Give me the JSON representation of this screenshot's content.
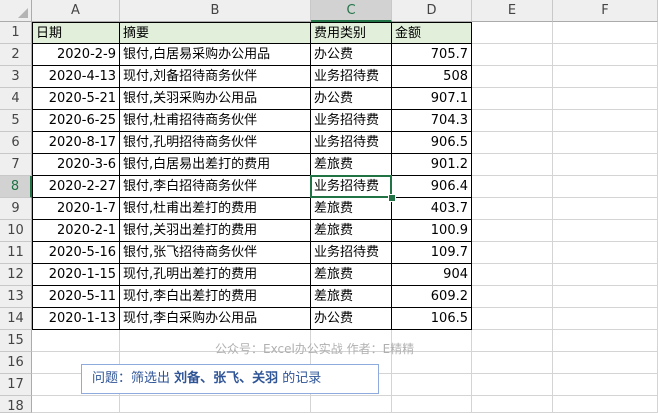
{
  "columns": [
    "A",
    "B",
    "C",
    "D",
    "E",
    "F"
  ],
  "selected_column": "C",
  "selected_row": 8,
  "row_numbers": [
    1,
    2,
    3,
    4,
    5,
    6,
    7,
    8,
    9,
    10,
    11,
    12,
    13,
    14,
    15,
    16,
    17,
    18
  ],
  "table": {
    "headers": [
      "日期",
      "摘要",
      "费用类别",
      "金额"
    ],
    "rows": [
      [
        "2020-2-9",
        "银付,白居易采购办公用品",
        "办公费",
        "705.7"
      ],
      [
        "2020-4-13",
        "现付,刘备招待商务伙伴",
        "业务招待费",
        "508"
      ],
      [
        "2020-5-21",
        "银付,关羽采购办公用品",
        "办公费",
        "907.1"
      ],
      [
        "2020-6-25",
        "银付,杜甫招待商务伙伴",
        "业务招待费",
        "704.3"
      ],
      [
        "2020-8-17",
        "银付,孔明招待商务伙伴",
        "业务招待费",
        "906.5"
      ],
      [
        "2020-3-6",
        "银付,白居易出差打的费用",
        "差旅费",
        "901.2"
      ],
      [
        "2020-2-27",
        "银付,李白招待商务伙伴",
        "业务招待费",
        "906.4"
      ],
      [
        "2020-1-7",
        "银付,杜甫出差打的费用",
        "差旅费",
        "403.7"
      ],
      [
        "2020-2-1",
        "银付,关羽出差打的费用",
        "差旅费",
        "100.9"
      ],
      [
        "2020-5-16",
        "银付,张飞招待商务伙伴",
        "业务招待费",
        "109.7"
      ],
      [
        "2020-1-15",
        "现付,孔明出差打的费用",
        "差旅费",
        "904"
      ],
      [
        "2020-5-11",
        "现付,李白出差打的费用",
        "差旅费",
        "609.2"
      ],
      [
        "2020-1-13",
        "现付,李白采购办公用品",
        "办公费",
        "106.5"
      ]
    ]
  },
  "watermark": "公众号：Excel办公实战 作者：E精精",
  "question": {
    "prefix": "问题：筛选出 ",
    "names": "刘备、张飞、关羽",
    "suffix": " 的记录"
  },
  "colors": {
    "header_fill": "#e2efda",
    "selection_green": "#217346",
    "question_text": "#2f5597",
    "question_border": "#8faadc"
  }
}
